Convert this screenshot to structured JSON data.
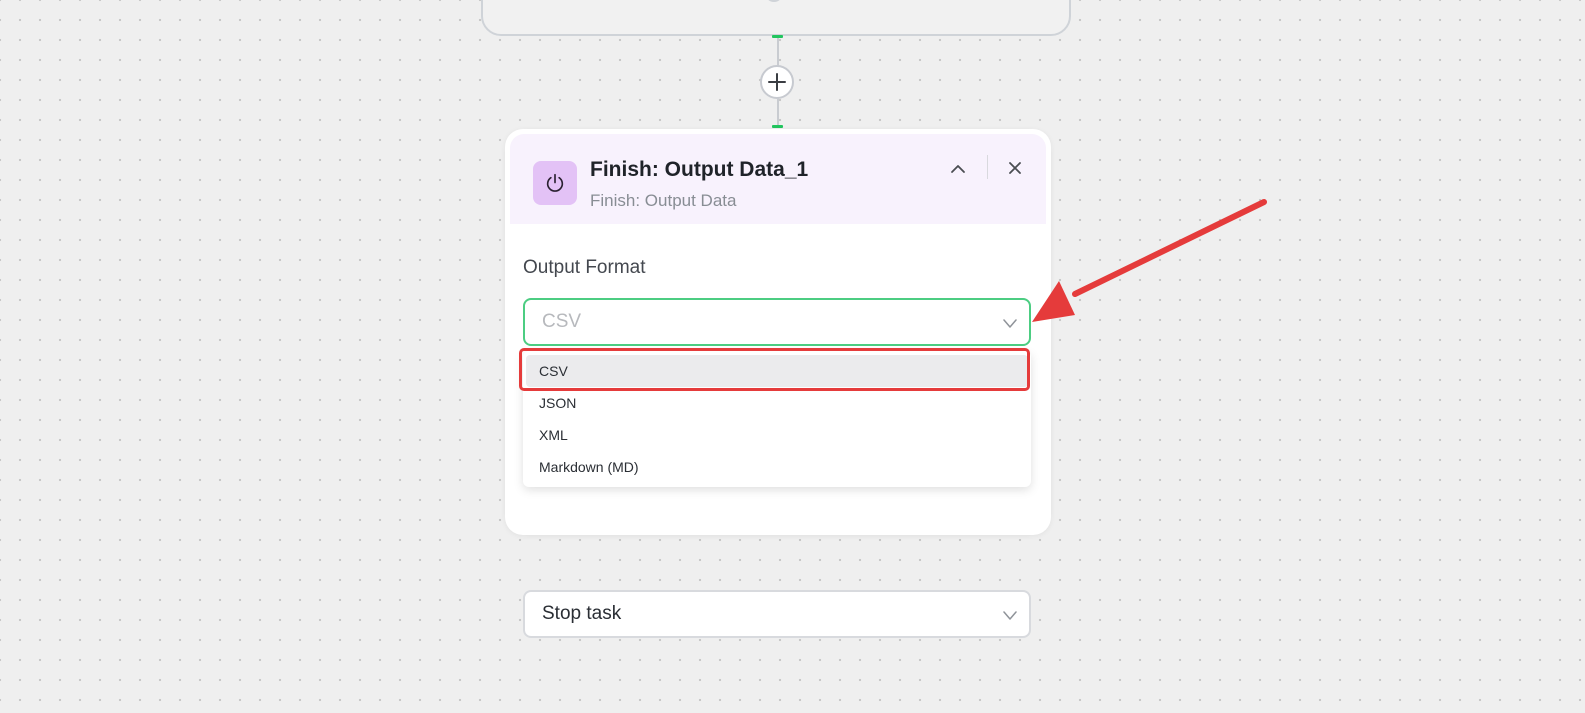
{
  "node": {
    "title": "Finish: Output Data_1",
    "subtitle": "Finish: Output Data",
    "icon": "power-icon",
    "icon_bg": "#e3c2f6",
    "header_bg": "#f8f2fd"
  },
  "output_format": {
    "label": "Output Format",
    "value": "CSV",
    "options": [
      "CSV",
      "JSON",
      "XML",
      "Markdown (MD)"
    ],
    "border_color": "#4ccd82"
  },
  "after_output": {
    "value": "Stop task"
  },
  "annotation": {
    "color": "#e53b3b"
  },
  "connector": {
    "handle_color": "#22c55e",
    "add_icon": "plus-icon"
  }
}
